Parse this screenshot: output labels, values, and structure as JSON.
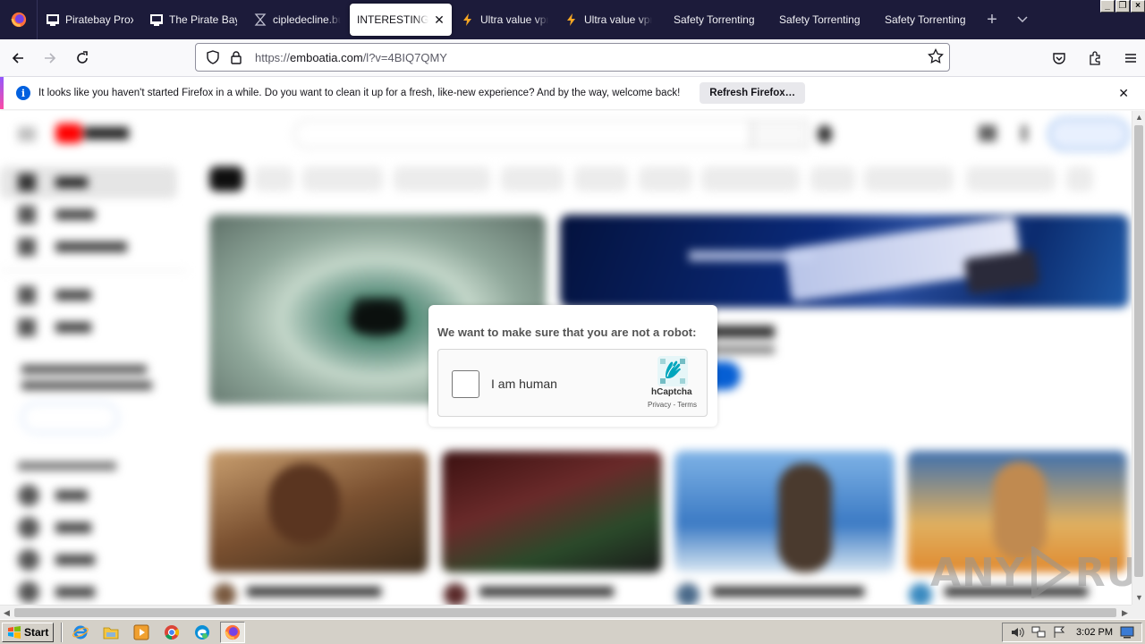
{
  "browser": {
    "tabs": [
      {
        "label": "Piratebay Proxy",
        "icon": "pirate-icon",
        "active": false
      },
      {
        "label": "The Pirate Bay",
        "icon": "pirate-icon",
        "active": false
      },
      {
        "label": "cipledecline.buzz",
        "icon": "hourglass-icon",
        "active": false
      },
      {
        "label": "INTERESTING FILE",
        "icon": "none",
        "active": true
      },
      {
        "label": "Ultra value vpn",
        "icon": "bolt-icon",
        "active": false
      },
      {
        "label": "Ultra value vpn",
        "icon": "bolt-icon",
        "active": false
      },
      {
        "label": "Safety Torrenting",
        "icon": "none",
        "active": false
      },
      {
        "label": "Safety Torrenting",
        "icon": "none",
        "active": false
      },
      {
        "label": "Safety Torrenting",
        "icon": "none",
        "active": false
      }
    ],
    "url": {
      "scheme": "https://",
      "host": "emboatia.com",
      "path": "/l?v=4BIQ7QMY"
    },
    "notification": {
      "message": "It looks like you haven't started Firefox in a while. Do you want to clean it up for a fresh, like-new experience? And by the way, welcome back!",
      "button_label": "Refresh Firefox…"
    }
  },
  "captcha": {
    "title": "We want to make sure that you are not a robot:",
    "checkbox_label": "I am human",
    "brand": "hCaptcha",
    "links": "Privacy - Terms"
  },
  "watermark": {
    "text_left": "ANY",
    "text_right": "RUN"
  },
  "taskbar": {
    "start_label": "Start",
    "clock": "3:02 PM"
  },
  "colors": {
    "tabstrip_bg": "#1c1b3a",
    "accent_blue": "#0060df",
    "hcaptcha_teal": "#00838f"
  }
}
